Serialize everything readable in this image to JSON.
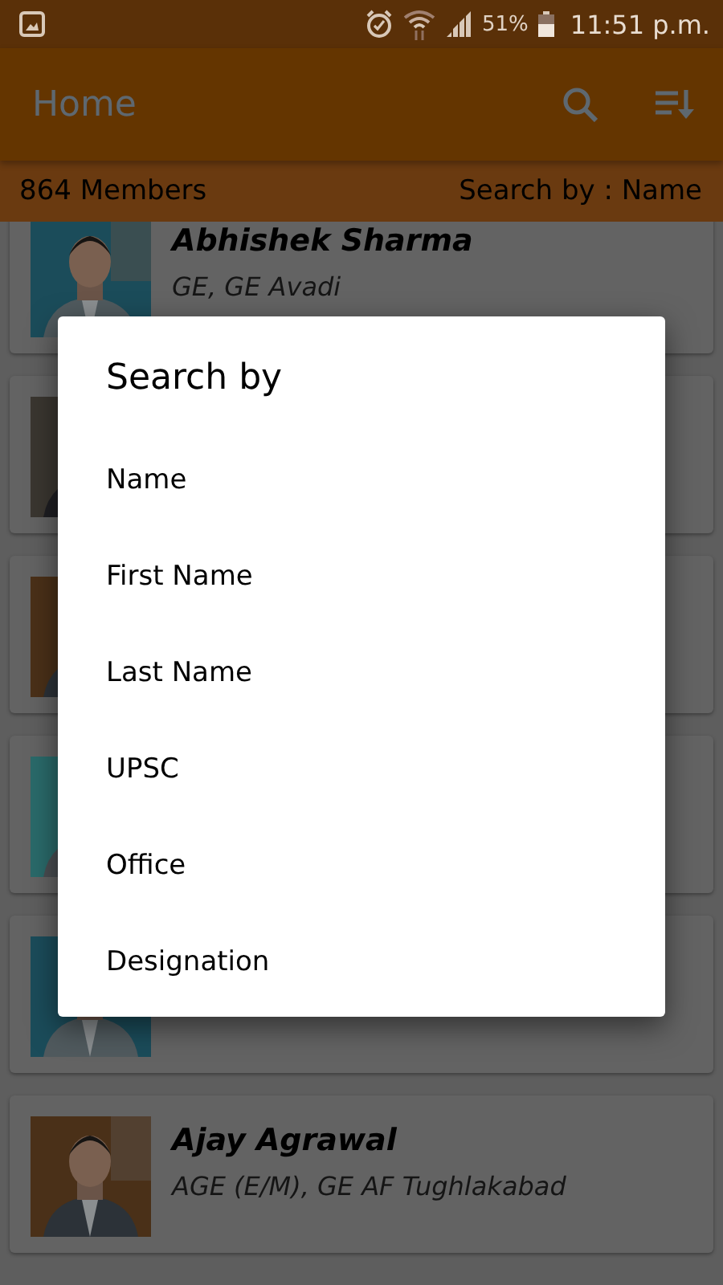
{
  "status_bar": {
    "battery_text": "51%",
    "time": "11:51 p.m."
  },
  "app_bar": {
    "title": "Home"
  },
  "subheader": {
    "count": "864 Members",
    "search_by": "Search by : Name"
  },
  "members": [
    {
      "kind": "full",
      "name": "Abhishek  Sharma",
      "detail": "GE,  GE Avadi"
    },
    {
      "kind": "covered"
    },
    {
      "kind": "covered"
    },
    {
      "kind": "covered"
    },
    {
      "kind": "covered"
    },
    {
      "kind": "full",
      "name": "Ajay  Agrawal",
      "detail": "AGE (E/M),  GE AF Tughlakabad"
    }
  ],
  "dialog": {
    "title": "Search by",
    "options": [
      "Name",
      "First Name",
      "Last Name",
      "UPSC",
      "Office",
      "Designation"
    ]
  }
}
